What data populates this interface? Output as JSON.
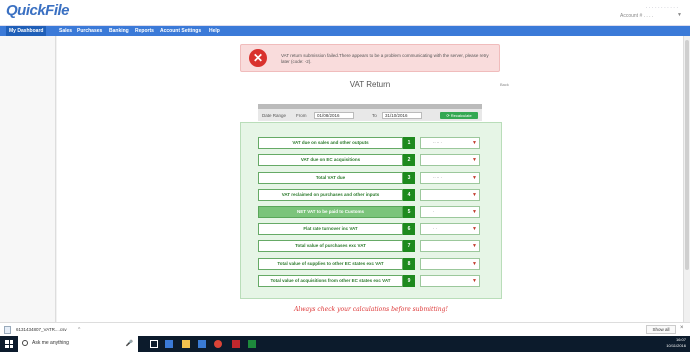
{
  "brand": {
    "logo_text": "QuickFile"
  },
  "account": {
    "top_text": "· · · · · · · · · · ·",
    "label": "Account # . . . .",
    "arrow": "▼"
  },
  "nav": [
    "My Dashboard",
    "Sales",
    "Purchases",
    "Banking",
    "Reports",
    "Account Settings",
    "Help"
  ],
  "alert": {
    "message": "VAT return submission failed.There appears to be a problem communicating with the server, please retry later (code: -2)."
  },
  "page": {
    "title": "VAT Return",
    "back_link": "Back"
  },
  "date_range": {
    "label": "Date Range",
    "from_label": "From",
    "from_value": "01/08/2016",
    "to_label": "To",
    "to_value": "31/10/2016",
    "recalc_label": "⟳ Recalculate"
  },
  "boxes": [
    {
      "label": "VAT due on sales and other outputs",
      "num": "1",
      "value": "·· ·· ·"
    },
    {
      "label": "VAT due on EC acquisitions",
      "num": "2",
      "value": ""
    },
    {
      "label": "Total VAT due",
      "num": "3",
      "value": "·· ·· ·"
    },
    {
      "label": "VAT reclaimed on purchases and other inputs",
      "num": "4",
      "value": ""
    },
    {
      "label": "NET VAT to be paid to Customs",
      "num": "5",
      "value": "·"
    },
    {
      "label": "Flat rate turnover inc VAT",
      "num": "6",
      "value": "· ·"
    },
    {
      "label": "Total value of purchases exc VAT",
      "num": "7",
      "value": ""
    },
    {
      "label": "Total value of supplies to other EC states exc VAT",
      "num": "8",
      "value": ""
    },
    {
      "label": "Total value of acquisitions from other EC states exc VAT",
      "num": "9",
      "value": ""
    }
  ],
  "warning": "Always check your calculations before submitting!",
  "download": {
    "file": "6131434807_VATR....csv",
    "caret": "^",
    "show_all": "Show all",
    "close": "×"
  },
  "taskbar": {
    "search_placeholder": "Ask me anything",
    "time": "16:07",
    "date": "10/11/2016"
  },
  "colors": {
    "nav": "#3b7ad8",
    "accent_green": "#1e8a1e",
    "alert_bg": "#f9dcdc",
    "error_red": "#d9322e"
  }
}
